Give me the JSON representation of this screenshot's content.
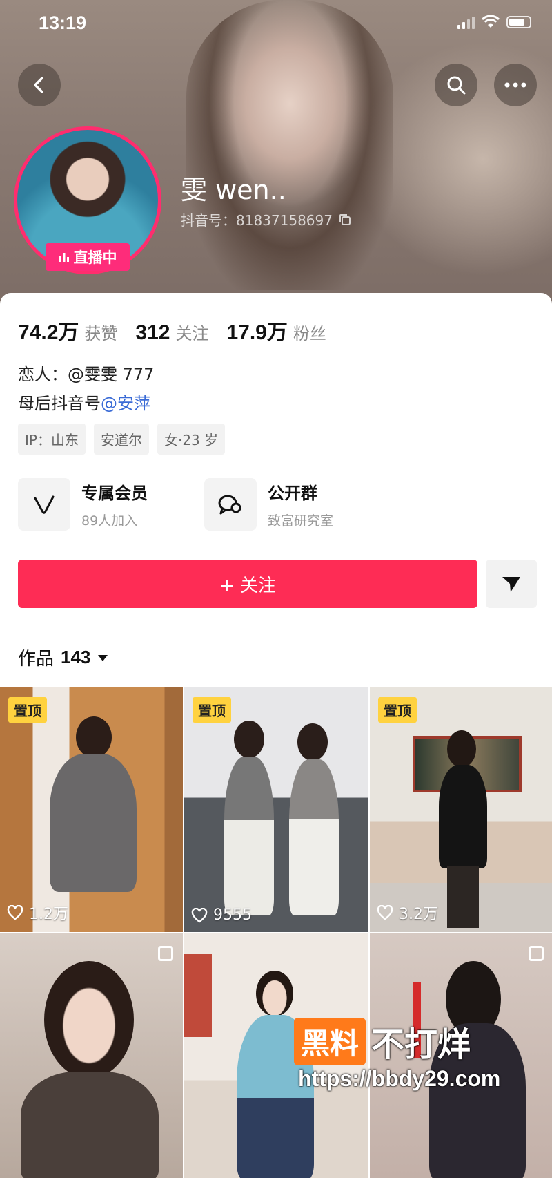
{
  "status_bar": {
    "time": "13:19"
  },
  "profile": {
    "name": "雯 wen..",
    "douyin_id": "抖音号：81837158697",
    "live_badge": "直播中",
    "accent": "#fe2c55"
  },
  "stats": [
    {
      "value": "74.2万",
      "label": "获赞"
    },
    {
      "value": "312",
      "label": "关注"
    },
    {
      "value": "17.9万",
      "label": "粉丝"
    }
  ],
  "bio": {
    "line1": "恋人：@雯雯 777",
    "line2_prefix": "母后抖音号",
    "line2_mention": "@安萍"
  },
  "tags": [
    "IP：山东",
    "安道尔",
    "女·23 岁"
  ],
  "features": [
    {
      "title": "专属会员",
      "subtitle": "89人加入",
      "icon": "vip-icon"
    },
    {
      "title": "公开群",
      "subtitle": "致富研究室",
      "icon": "chat-group-icon"
    }
  ],
  "follow_button": "+ 关注",
  "works": {
    "label": "作品",
    "count": "143"
  },
  "grid": [
    {
      "pinned": "置顶",
      "likes": "1.2万"
    },
    {
      "pinned": "置顶",
      "likes": "9555"
    },
    {
      "pinned": "置顶",
      "likes": "3.2万"
    },
    {},
    {},
    {}
  ],
  "watermark": {
    "box": "黑料",
    "text": "不打烊",
    "url": "https://bbdy29.com"
  }
}
